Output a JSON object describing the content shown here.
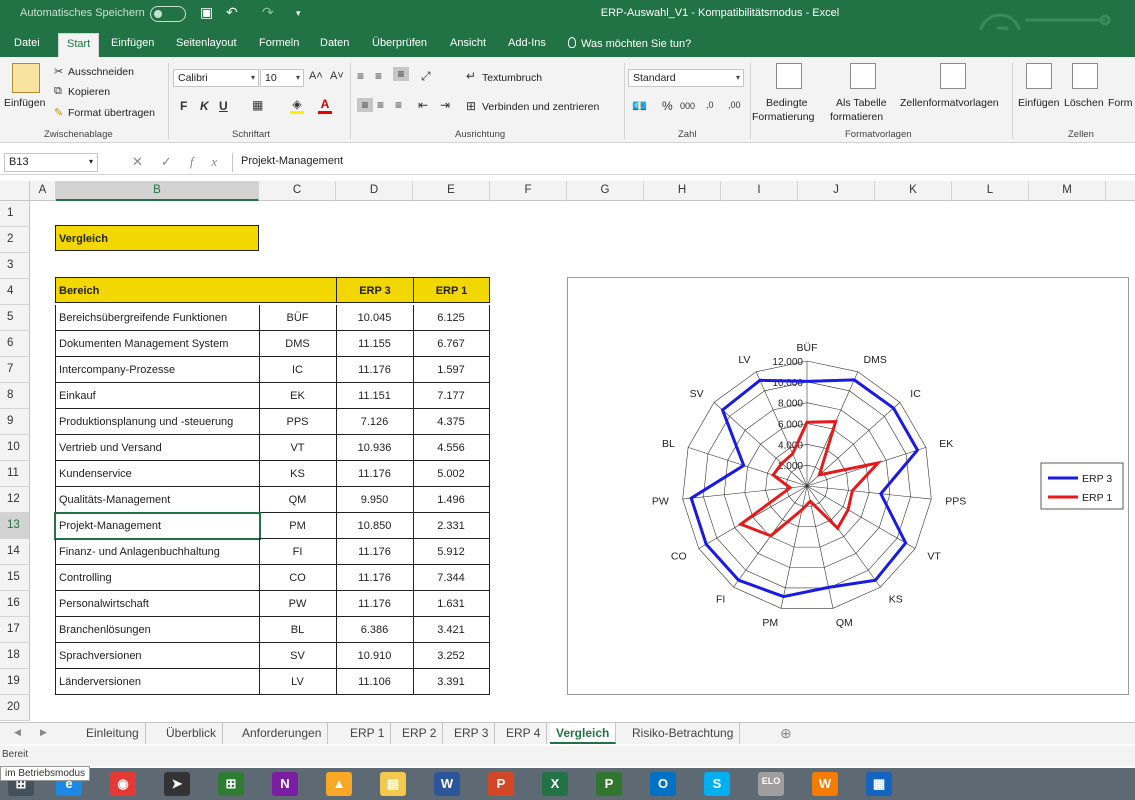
{
  "titlebar": {
    "autosave_label": "Automatisches Speichern",
    "undo_icon": "↶",
    "redo_icon": "↷",
    "save_icon": "▣",
    "title": "ERP-Auswahl_V1 - Kompatibilitätsmodus - Excel"
  },
  "tabs": [
    "Datei",
    "Start",
    "Einfügen",
    "Seitenlayout",
    "Formeln",
    "Daten",
    "Überprüfen",
    "Ansicht",
    "Add-Ins"
  ],
  "tell_me": "Was möchten Sie tun?",
  "ribbon": {
    "paste": "Einfügen",
    "cut": "Ausschneiden",
    "copy": "Kopieren",
    "format_painter": "Format übertragen",
    "clipboard_group": "Zwischenablage",
    "font_name": "Calibri",
    "font_size": "10",
    "bold": "F",
    "italic": "K",
    "underline": "U",
    "font_group": "Schriftart",
    "wrap_text": "Textumbruch",
    "merge_center": "Verbinden und zentrieren",
    "alignment_group": "Ausrichtung",
    "number_format": "Standard",
    "percent": "%",
    "thousands": "000",
    "number_group": "Zahl",
    "conditional_1": "Bedingte",
    "conditional_2": "Formatierung",
    "as_table_1": "Als Tabelle",
    "as_table_2": "formatieren",
    "cell_styles": "Zellenformatvorlagen",
    "styles_group": "Formatvorlagen",
    "insert": "Einfügen",
    "delete": "Löschen",
    "format": "Form",
    "cells_group": "Zellen"
  },
  "formula_bar": {
    "name_box": "B13",
    "content": "Projekt-Management"
  },
  "columns": [
    "A",
    "B",
    "C",
    "D",
    "E",
    "F",
    "G",
    "H",
    "I",
    "J",
    "K",
    "L",
    "M"
  ],
  "rows": [
    "1",
    "2",
    "3",
    "4",
    "5",
    "6",
    "7",
    "8",
    "9",
    "10",
    "11",
    "12",
    "13",
    "14",
    "15",
    "16",
    "17",
    "18",
    "19",
    "20"
  ],
  "sheet": {
    "title": "Vergleich",
    "headers": {
      "area": "Bereich",
      "erp3": "ERP 3",
      "erp1": "ERP 1"
    },
    "table": [
      {
        "name": "Bereichsübergreifende Funktionen",
        "code": "BÜF",
        "erp3": "10.045",
        "erp1": "6.125"
      },
      {
        "name": "Dokumenten Management System",
        "code": "DMS",
        "erp3": "11.155",
        "erp1": "6.767"
      },
      {
        "name": "Intercompany-Prozesse",
        "code": "IC",
        "erp3": "11.176",
        "erp1": "1.597"
      },
      {
        "name": "Einkauf",
        "code": "EK",
        "erp3": "11.151",
        "erp1": "7.177"
      },
      {
        "name": "Produktionsplanung und -steuerung",
        "code": "PPS",
        "erp3": "7.126",
        "erp1": "4.375"
      },
      {
        "name": "Vertrieb und Versand",
        "code": "VT",
        "erp3": "10.936",
        "erp1": "4.556"
      },
      {
        "name": "Kundenservice",
        "code": "KS",
        "erp3": "11.176",
        "erp1": "5.002"
      },
      {
        "name": "Qualitäts-Management",
        "code": "QM",
        "erp3": "9.950",
        "erp1": "1.496"
      },
      {
        "name": "Projekt-Management",
        "code": "PM",
        "erp3": "10.850",
        "erp1": "2.331"
      },
      {
        "name": "Finanz- und Anlagenbuchhaltung",
        "code": "FI",
        "erp3": "11.176",
        "erp1": "5.912"
      },
      {
        "name": "Controlling",
        "code": "CO",
        "erp3": "11.176",
        "erp1": "7.344"
      },
      {
        "name": "Personalwirtschaft",
        "code": "PW",
        "erp3": "11.176",
        "erp1": "1.631"
      },
      {
        "name": "Branchenlösungen",
        "code": "BL",
        "erp3": "6.386",
        "erp1": "3.421"
      },
      {
        "name": "Sprachversionen",
        "code": "SV",
        "erp3": "10.910",
        "erp1": "3.252"
      },
      {
        "name": "Länderversionen",
        "code": "LV",
        "erp3": "11.106",
        "erp1": "3.391"
      }
    ]
  },
  "chart_data": {
    "type": "radar",
    "categories": [
      "BÜF",
      "DMS",
      "IC",
      "EK",
      "PPS",
      "VT",
      "KS",
      "QM",
      "PM",
      "FI",
      "CO",
      "PW",
      "BL",
      "SV",
      "LV"
    ],
    "series": [
      {
        "name": "ERP 3",
        "color": "#1a1ae6",
        "values": [
          10045,
          11155,
          11176,
          11151,
          7126,
          10936,
          11176,
          9950,
          10850,
          11176,
          11176,
          11176,
          6386,
          10910,
          11106
        ]
      },
      {
        "name": "ERP 1",
        "color": "#e61a1a",
        "values": [
          6125,
          6767,
          1597,
          7177,
          4375,
          4556,
          5002,
          1496,
          2331,
          5912,
          7344,
          1631,
          3421,
          3252,
          3391
        ]
      }
    ],
    "axis_ticks": [
      "2.000",
      "4.000",
      "6.000",
      "8.000",
      "10.000",
      "12.000"
    ],
    "rmax": 12000,
    "legend_position": "right",
    "grid": true
  },
  "sheet_tabs": [
    "Einleitung",
    "Überblick",
    "Anforderungen",
    "ERP 1",
    "ERP 2",
    "ERP 3",
    "ERP 4",
    "Vergleich",
    "Risiko-Betrachtung"
  ],
  "active_sheet": "Vergleich",
  "status": "Bereit",
  "tooltip": "im Betriebsmodus",
  "taskbar": [
    {
      "name": "ie",
      "glyph": "e",
      "color": "#1e88e5"
    },
    {
      "name": "chrome",
      "glyph": "◉",
      "color": "#e53935"
    },
    {
      "name": "arrow",
      "glyph": "➤",
      "color": "#333333"
    },
    {
      "name": "store",
      "glyph": "⊞",
      "color": "#2e7d32"
    },
    {
      "name": "onenote",
      "glyph": "N",
      "color": "#7b1fa2"
    },
    {
      "name": "chart",
      "glyph": "▲",
      "color": "#f9a825"
    },
    {
      "name": "explorer",
      "glyph": "▤",
      "color": "#f2c94c"
    },
    {
      "name": "word",
      "glyph": "W",
      "color": "#2b579a"
    },
    {
      "name": "powerpoint",
      "glyph": "P",
      "color": "#d24726"
    },
    {
      "name": "excel",
      "glyph": "X",
      "color": "#217346"
    },
    {
      "name": "project",
      "glyph": "P",
      "color": "#31752f"
    },
    {
      "name": "outlook",
      "glyph": "O",
      "color": "#0072c6"
    },
    {
      "name": "skype",
      "glyph": "S",
      "color": "#00aff0"
    },
    {
      "name": "elo",
      "glyph": "ELO",
      "color": "#9e9e9e"
    },
    {
      "name": "w-app",
      "glyph": "W",
      "color": "#f57c00"
    },
    {
      "name": "network",
      "glyph": "▦",
      "color": "#1565c0"
    }
  ]
}
